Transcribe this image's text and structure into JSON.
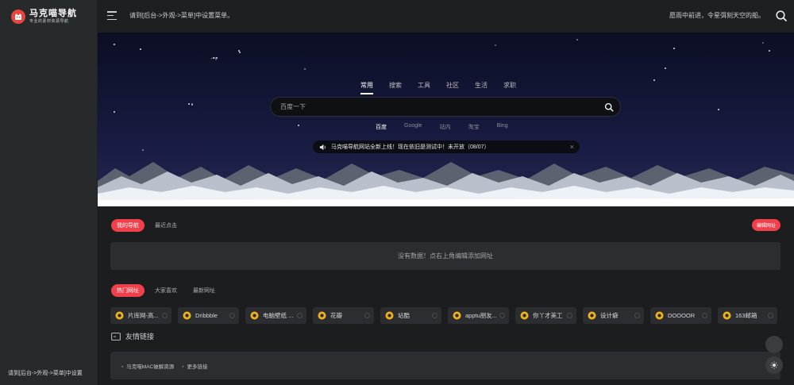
{
  "sidebar": {
    "logo_title": "马克喵导航",
    "logo_subtitle": "专业的素材资源导航",
    "footer_notice": "请到[后台->外观->菜单]中设置"
  },
  "topbar": {
    "notice": "请到[后台->外观->菜单]中设置菜单。",
    "motto": "愿雨中前进，令星弭刻天空的船。"
  },
  "search": {
    "tabs": [
      "常用",
      "搜索",
      "工具",
      "社区",
      "生活",
      "求职"
    ],
    "active_tab": "常用",
    "placeholder": "百度一下",
    "engines": [
      "百度",
      "Google",
      "站内",
      "淘宝",
      "Bing"
    ],
    "active_engine": "百度"
  },
  "announcement": {
    "text": "马克喵导航网站全新上线！现在依旧是测试中！未开放（08/07）",
    "close": "×"
  },
  "my_nav": {
    "tabs": [
      "我的导航",
      "最近点击"
    ],
    "active_tab": "我的导航",
    "edit_label": "编辑网址",
    "empty_text": "没有数据！点右上角编辑添加网址"
  },
  "hot_sites": {
    "tabs": [
      "热门网址",
      "大家喜欢",
      "最新网址"
    ],
    "active_tab": "热门网址",
    "items": [
      "片库网-高...",
      "Dribbble",
      "电脑壁纸 ...",
      "花瓣",
      "站酷",
      "apptu朋友...",
      "你丫才美工",
      "设计癖",
      "DOOOOR",
      "163邮箱"
    ]
  },
  "friend_links": {
    "title": "友情链接",
    "items": [
      "马克喵MAC破解资源",
      "更多链接"
    ]
  },
  "colors": {
    "accent": "#f1404b",
    "sidebar_bg": "#272a2b",
    "content_bg": "#1c1d1f",
    "card_bg": "#2b2d30"
  }
}
